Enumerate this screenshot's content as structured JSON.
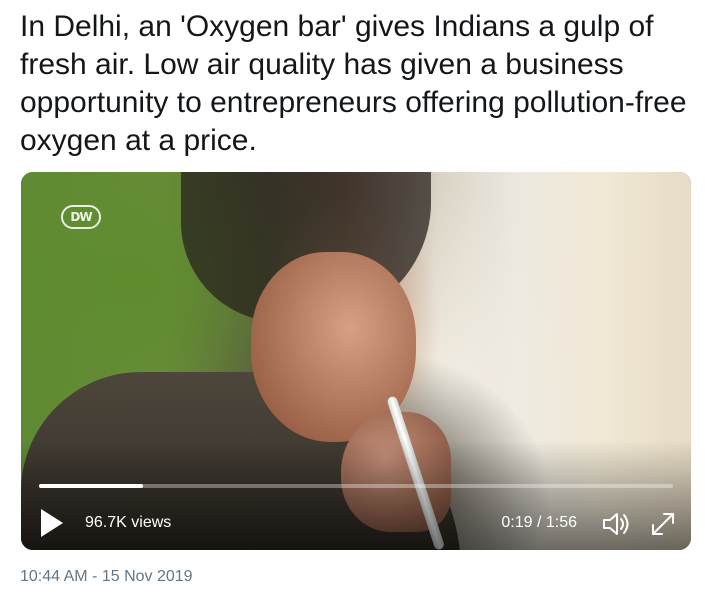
{
  "tweet": {
    "text": "In Delhi, an 'Oxygen bar' gives Indians a gulp of fresh air. Low air quality has given a business opportunity to entrepreneurs offering pollution-free oxygen at a price.",
    "timestamp": "10:44 AM - 15 Nov 2019"
  },
  "video": {
    "logo_text": "DW",
    "views": "96.7K views",
    "time_display": "0:19 / 1:56",
    "progress_fraction": 0.164,
    "play_icon": "play-icon",
    "volume_icon": "volume-icon",
    "fullscreen_icon": "fullscreen-icon"
  },
  "colors": {
    "text": "#14171a",
    "timestamp": "#657786",
    "control_text": "#ffffff"
  }
}
